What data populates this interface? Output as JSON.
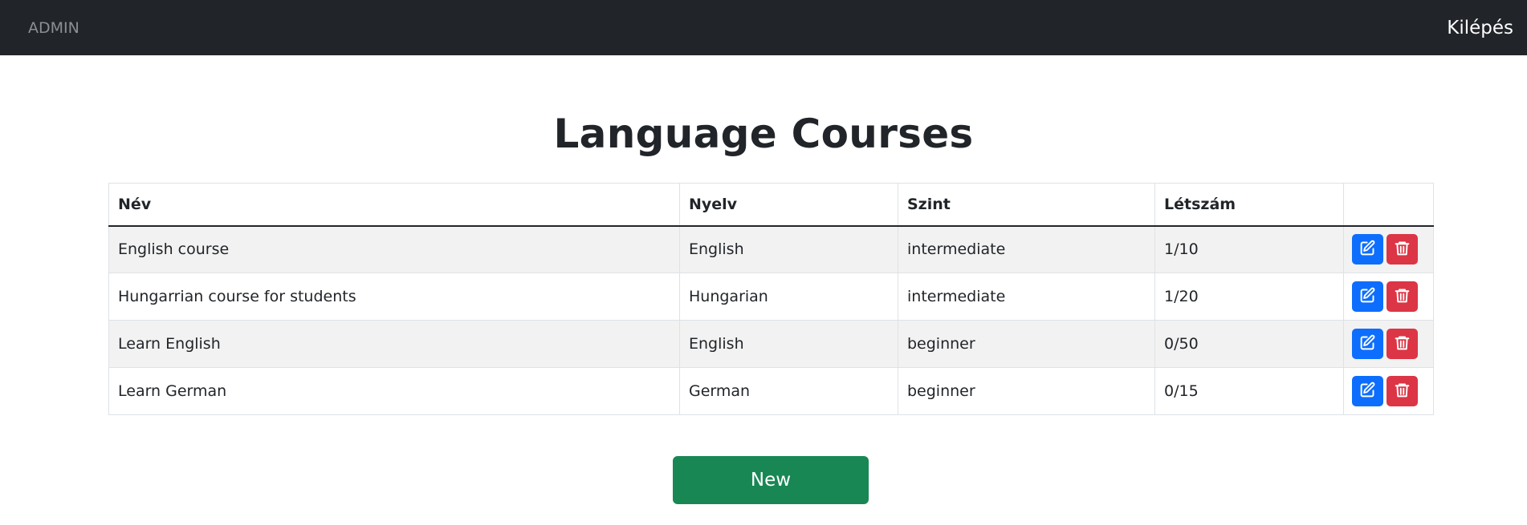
{
  "navbar": {
    "brand": "ADMIN",
    "logout": "Kilépés"
  },
  "page": {
    "title": "Language Courses"
  },
  "table": {
    "headers": [
      "Név",
      "Nyelv",
      "Szint",
      "Létszám",
      ""
    ],
    "rows": [
      {
        "name": "English course",
        "language": "English",
        "level": "intermediate",
        "count": "1/10"
      },
      {
        "name": "Hungarrian course for students",
        "language": "Hungarian",
        "level": "intermediate",
        "count": "1/20"
      },
      {
        "name": "Learn English",
        "language": "English",
        "level": "beginner",
        "count": "0/50"
      },
      {
        "name": "Learn German",
        "language": "German",
        "level": "beginner",
        "count": "0/15"
      }
    ]
  },
  "actions": {
    "new_label": "New"
  },
  "icons": {
    "edit": "edit-icon",
    "delete": "trash-icon"
  },
  "colors": {
    "navbar": "#212529",
    "edit": "#0d6efd",
    "delete": "#dc3545",
    "new": "#198754",
    "stripe": "#f2f2f2"
  }
}
